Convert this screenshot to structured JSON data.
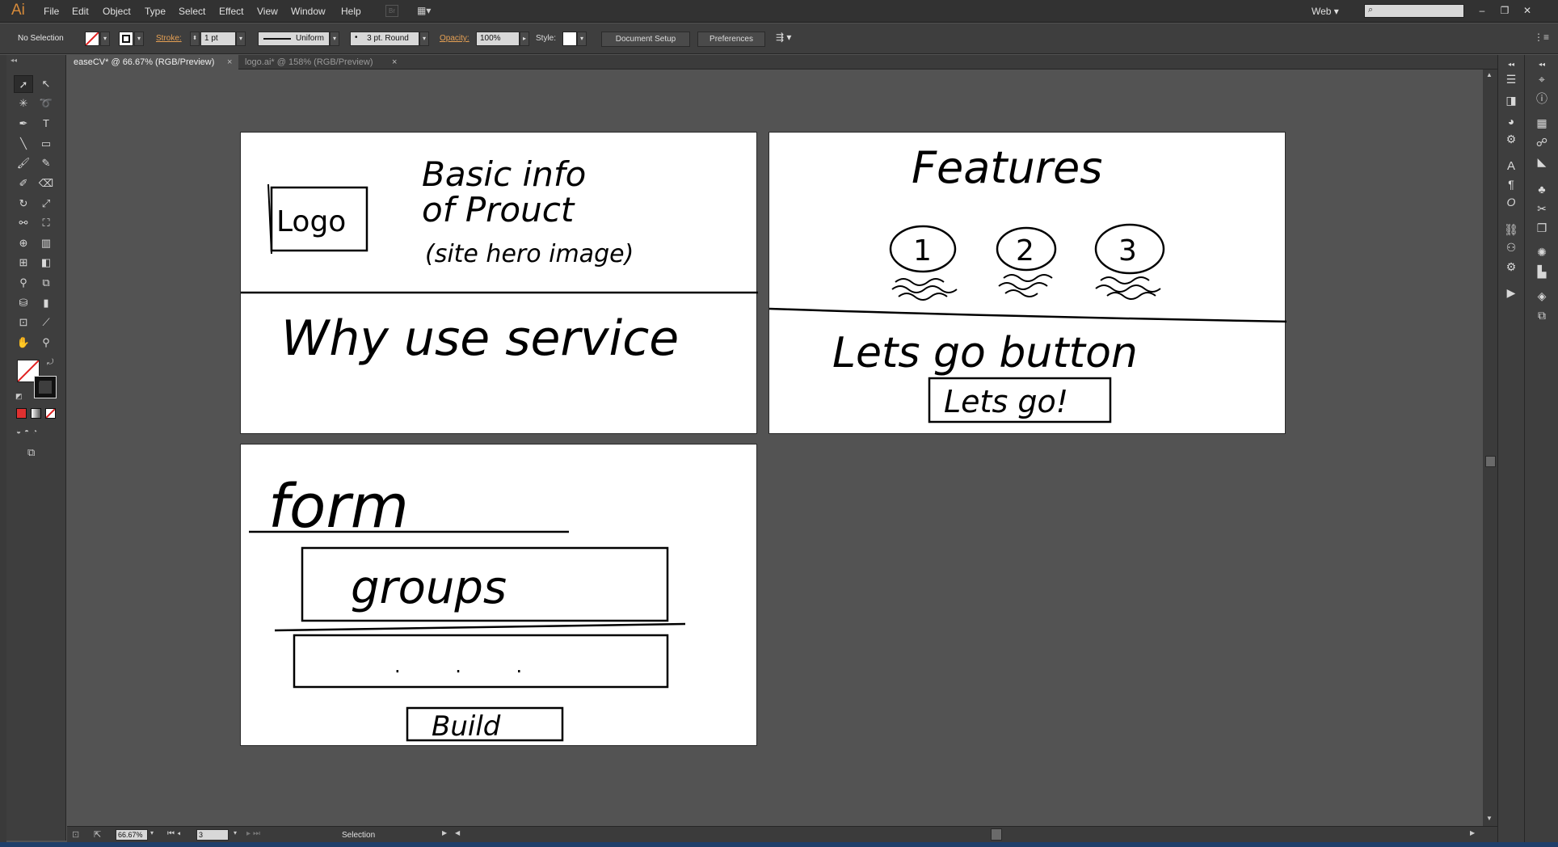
{
  "app": {
    "logo": "Ai",
    "menu": [
      "File",
      "Edit",
      "Object",
      "Type",
      "Select",
      "Effect",
      "View",
      "Window",
      "Help"
    ],
    "workspace": "Web"
  },
  "control_bar": {
    "selection_state": "No Selection",
    "stroke_label": "Stroke:",
    "stroke_weight": "1 pt",
    "profile": "Uniform",
    "brush": "3 pt. Round",
    "opacity_label": "Opacity:",
    "opacity_value": "100%",
    "style_label": "Style:",
    "document_setup": "Document Setup",
    "preferences": "Preferences"
  },
  "tabs": [
    {
      "label": "easeCV* @ 66.67% (RGB/Preview)",
      "active": true
    },
    {
      "label": "logo.ai* @ 158% (RGB/Preview)",
      "active": false
    }
  ],
  "artboards": {
    "a1": {
      "logo_box": "Logo",
      "basic_info_line1": "Basic info",
      "basic_info_line2": "of Prouct",
      "hero_note": "(site hero image)",
      "why_text": "Why use service"
    },
    "a2": {
      "features_title": "Features",
      "feature_numbers": [
        "1",
        "2",
        "3"
      ],
      "lets_go_caption": "Lets go button",
      "lets_go_button": "Lets go!"
    },
    "a3": {
      "form_title": "form",
      "groups_box": "groups",
      "dots": ". . .",
      "build_button": "Build"
    }
  },
  "status_bar": {
    "zoom": "66.67%",
    "artboard_number": "3",
    "tool_status": "Selection"
  },
  "colors": {
    "app_bg": "#535353",
    "panel_bg": "#3e3e3e",
    "menubar_bg": "#323232",
    "accent_orange": "#e5a054",
    "artboard": "#ffffff"
  }
}
